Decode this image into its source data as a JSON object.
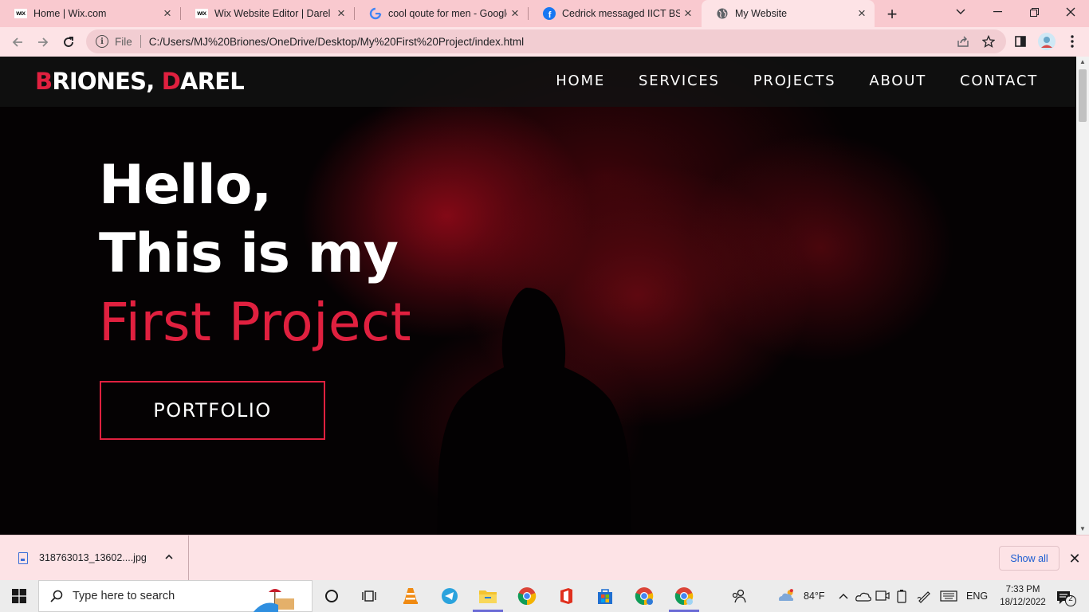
{
  "browser": {
    "tabs": [
      {
        "title": "Home | Wix.com",
        "icon": "wix-icon",
        "active": false
      },
      {
        "title": "Wix Website Editor | Darel Pr",
        "icon": "wix-icon",
        "active": false
      },
      {
        "title": "cool qoute for men - Google",
        "icon": "google-icon",
        "active": false
      },
      {
        "title": "Cedrick messaged IICT BSIT",
        "icon": "facebook-icon",
        "active": false
      },
      {
        "title": "My Website",
        "icon": "globe-icon",
        "active": true
      }
    ],
    "omnibox": {
      "scheme": "File",
      "url": "C:/Users/MJ%20Briones/OneDrive/Desktop/My%20First%20Project/index.html"
    },
    "colors": {
      "frame": "#f9c9cf",
      "toolbar": "#fde3e6"
    }
  },
  "site": {
    "logo": {
      "first_initial": "B",
      "first_rest": "RIONES, ",
      "second_initial": "D",
      "second_rest": "AREL"
    },
    "nav": [
      "HOME",
      "SERVICES",
      "PROJECTS",
      "ABOUT",
      "CONTACT"
    ],
    "hero": {
      "line1": "Hello,",
      "line2": "This is my",
      "line3": "First Project"
    },
    "button": "PORTFOLIO",
    "colors": {
      "accent": "#e0203f",
      "text": "#ffffff",
      "background": "#000000"
    }
  },
  "downloads": {
    "file_name": "318763013_13602....jpg",
    "show_all": "Show all"
  },
  "taskbar": {
    "search_placeholder": "Type here to search",
    "weather": "84°F",
    "language": "ENG",
    "time": "7:33 PM",
    "date": "18/12/2022",
    "notification_count": "2"
  }
}
